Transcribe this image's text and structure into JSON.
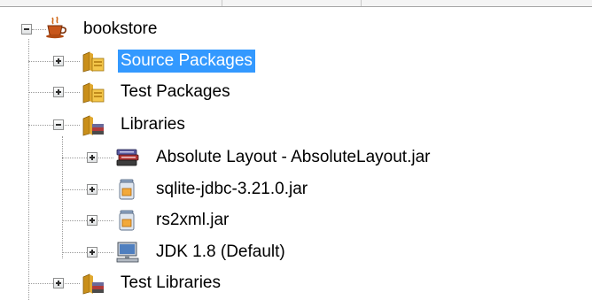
{
  "tree": {
    "root": {
      "label": "bookstore",
      "icon": "coffee-cup-project-icon",
      "expanded": true
    },
    "children": [
      {
        "label": "Source Packages",
        "icon": "package-folder-icon",
        "expanded": false,
        "selected": true
      },
      {
        "label": "Test Packages",
        "icon": "package-folder-icon",
        "expanded": false
      },
      {
        "label": "Libraries",
        "icon": "library-folder-icon",
        "expanded": true,
        "children": [
          {
            "label": "Absolute Layout - AbsoluteLayout.jar",
            "icon": "book-stack-icon",
            "expanded": false
          },
          {
            "label": "sqlite-jdbc-3.21.0.jar",
            "icon": "jar-icon",
            "expanded": false
          },
          {
            "label": "rs2xml.jar",
            "icon": "jar-icon",
            "expanded": false
          },
          {
            "label": "JDK 1.8 (Default)",
            "icon": "computer-icon",
            "expanded": false
          }
        ]
      },
      {
        "label": "Test Libraries",
        "icon": "library-folder-icon",
        "expanded": false
      }
    ]
  },
  "colors": {
    "selection": "#3399ff",
    "selection_text": "#ffffff"
  }
}
